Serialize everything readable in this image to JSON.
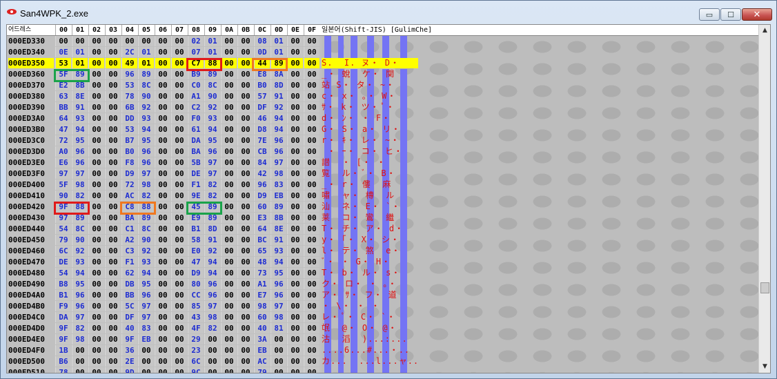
{
  "window": {
    "title": "San4WPK_2.exe",
    "minimize": "▭",
    "maximize": "☐",
    "close": "✕"
  },
  "header": {
    "address_label": "어드레스",
    "columns": [
      "00",
      "01",
      "02",
      "03",
      "04",
      "05",
      "06",
      "07",
      "08",
      "09",
      "0A",
      "0B",
      "0C",
      "0D",
      "0E",
      "0F"
    ],
    "text_label": "일본어(Shift-JIS) [GulimChe]"
  },
  "rows": [
    {
      "addr": "000ED330",
      "bytes": [
        "00",
        "00",
        "00",
        "00",
        "00",
        "00",
        "00",
        "00",
        "02",
        "01",
        "00",
        "00",
        "08",
        "01",
        "00",
        "00"
      ],
      "text": ""
    },
    {
      "addr": "000ED340",
      "bytes": [
        "0E",
        "01",
        "00",
        "00",
        "2C",
        "01",
        "00",
        "00",
        "07",
        "01",
        "00",
        "00",
        "0D",
        "01",
        "00",
        "00"
      ],
      "text": ""
    },
    {
      "addr": "000ED350",
      "bytes": [
        "53",
        "01",
        "00",
        "00",
        "49",
        "01",
        "00",
        "00",
        "C7",
        "88",
        "00",
        "00",
        "44",
        "89",
        "00",
        "00"
      ],
      "text": "S.  I. ヌ・ D・  ",
      "highlight": true
    },
    {
      "addr": "000ED360",
      "bytes": [
        "5F",
        "89",
        "00",
        "00",
        "96",
        "89",
        "00",
        "00",
        "B9",
        "89",
        "00",
        "00",
        "E8",
        "8A",
        "00",
        "00"
      ],
      "text": "_・ 蛻  ケ・ 関 "
    },
    {
      "addr": "000ED370",
      "bytes": [
        "E2",
        "8B",
        "00",
        "00",
        "53",
        "8C",
        "00",
        "00",
        "C0",
        "8C",
        "00",
        "00",
        "B0",
        "8D",
        "00",
        "00"
      ],
      "text": "站 S・ タ・ ~・"
    },
    {
      "addr": "000ED380",
      "bytes": [
        "63",
        "8E",
        "00",
        "00",
        "78",
        "90",
        "00",
        "00",
        "A1",
        "90",
        "00",
        "00",
        "57",
        "91",
        "00",
        "00"
      ],
      "text": "c・ x・ ｡・ W・"
    },
    {
      "addr": "000ED390",
      "bytes": [
        "BB",
        "91",
        "00",
        "00",
        "6B",
        "92",
        "00",
        "00",
        "C2",
        "92",
        "00",
        "00",
        "DF",
        "92",
        "00",
        "00"
      ],
      "text": "ｻ・ k・ ツ・ ﾟ・"
    },
    {
      "addr": "000ED3A0",
      "bytes": [
        "64",
        "93",
        "00",
        "00",
        "DD",
        "93",
        "00",
        "00",
        "F0",
        "93",
        "00",
        "00",
        "46",
        "94",
        "00",
        "00"
      ],
      "text": "d・ ﾝ・ ・ F・"
    },
    {
      "addr": "000ED3B0",
      "bytes": [
        "47",
        "94",
        "00",
        "00",
        "53",
        "94",
        "00",
        "00",
        "61",
        "94",
        "00",
        "00",
        "D8",
        "94",
        "00",
        "00"
      ],
      "text": "G・ S・ a・ リ・"
    },
    {
      "addr": "000ED3C0",
      "bytes": [
        "72",
        "95",
        "00",
        "00",
        "B7",
        "95",
        "00",
        "00",
        "DA",
        "95",
        "00",
        "00",
        "7E",
        "96",
        "00",
        "00"
      ],
      "text": "r・ ｷ・ レ・ ~・"
    },
    {
      "addr": "000ED3D0",
      "bytes": [
        "A0",
        "96",
        "00",
        "00",
        "B0",
        "96",
        "00",
        "00",
        "BA",
        "96",
        "00",
        "00",
        "CB",
        "96",
        "00",
        "00"
      ],
      "text": " ・ ｰ・ コ・ ヒ・"
    },
    {
      "addr": "000ED3E0",
      "bytes": [
        "E6",
        "96",
        "00",
        "00",
        "F8",
        "96",
        "00",
        "00",
        "5B",
        "97",
        "00",
        "00",
        "84",
        "97",
        "00",
        "00"
      ],
      "text": "譛  ・ [・ ・"
    },
    {
      "addr": "000ED3F0",
      "bytes": [
        "97",
        "97",
        "00",
        "00",
        "D9",
        "97",
        "00",
        "00",
        "DE",
        "97",
        "00",
        "00",
        "42",
        "98",
        "00",
        "00"
      ],
      "text": "覧  ル・ ﾞ・ B・"
    },
    {
      "addr": "000ED400",
      "bytes": [
        "5F",
        "98",
        "00",
        "00",
        "72",
        "98",
        "00",
        "00",
        "F1",
        "82",
        "00",
        "00",
        "96",
        "83",
        "00",
        "00"
      ],
      "text": "_・ r・ 僂  麻"
    },
    {
      "addr": "000ED410",
      "bytes": [
        "90",
        "82",
        "00",
        "00",
        "AC",
        "82",
        "00",
        "00",
        "9E",
        "82",
        "00",
        "00",
        "D9",
        "EB",
        "00",
        "00"
      ],
      "text": "嘯  ャ・ 槫  ル"
    },
    {
      "addr": "000ED420",
      "bytes": [
        "9F",
        "88",
        "00",
        "00",
        "C8",
        "88",
        "00",
        "00",
        "45",
        "89",
        "00",
        "00",
        "60",
        "89",
        "00",
        "00"
      ],
      "text": "汕  ネ・ E・ `・"
    },
    {
      "addr": "000ED430",
      "bytes": [
        "97",
        "89",
        "00",
        "00",
        "BA",
        "89",
        "00",
        "00",
        "E9",
        "89",
        "00",
        "00",
        "E3",
        "8B",
        "00",
        "00"
      ],
      "text": "莱  コ・ 鸞  繼"
    },
    {
      "addr": "000ED440",
      "bytes": [
        "54",
        "8C",
        "00",
        "00",
        "C1",
        "8C",
        "00",
        "00",
        "B1",
        "8D",
        "00",
        "00",
        "64",
        "8E",
        "00",
        "00"
      ],
      "text": "T・ チ・ ア・ d・"
    },
    {
      "addr": "000ED450",
      "bytes": [
        "79",
        "90",
        "00",
        "00",
        "A2",
        "90",
        "00",
        "00",
        "58",
        "91",
        "00",
        "00",
        "BC",
        "91",
        "00",
        "00"
      ],
      "text": "y・ ｢・ X・ シ・"
    },
    {
      "addr": "000ED460",
      "bytes": [
        "6C",
        "92",
        "00",
        "00",
        "C3",
        "92",
        "00",
        "00",
        "E0",
        "92",
        "00",
        "00",
        "65",
        "93",
        "00",
        "00"
      ],
      "text": "l・ テ・ 煞  e・"
    },
    {
      "addr": "000ED470",
      "bytes": [
        "DE",
        "93",
        "00",
        "00",
        "F1",
        "93",
        "00",
        "00",
        "47",
        "94",
        "00",
        "00",
        "48",
        "94",
        "00",
        "00"
      ],
      "text": "ﾞ・ ・ G・ H・"
    },
    {
      "addr": "000ED480",
      "bytes": [
        "54",
        "94",
        "00",
        "00",
        "62",
        "94",
        "00",
        "00",
        "D9",
        "94",
        "00",
        "00",
        "73",
        "95",
        "00",
        "00"
      ],
      "text": "T・ b・ ル・ s・"
    },
    {
      "addr": "000ED490",
      "bytes": [
        "B8",
        "95",
        "00",
        "00",
        "DB",
        "95",
        "00",
        "00",
        "80",
        "96",
        "00",
        "00",
        "A1",
        "96",
        "00",
        "00"
      ],
      "text": "ク・ ロ・ ・ ｡・"
    },
    {
      "addr": "000ED4A0",
      "bytes": [
        "B1",
        "96",
        "00",
        "00",
        "BB",
        "96",
        "00",
        "00",
        "CC",
        "96",
        "00",
        "00",
        "E7",
        "96",
        "00",
        "00"
      ],
      "text": "ア・ ｻ・ フ・ 道"
    },
    {
      "addr": "000ED4B0",
      "bytes": [
        "F9",
        "96",
        "00",
        "00",
        "5C",
        "97",
        "00",
        "00",
        "85",
        "97",
        "00",
        "00",
        "98",
        "97",
        "00",
        "00"
      ],
      "text": "・ \\・ ・ ・"
    },
    {
      "addr": "000ED4C0",
      "bytes": [
        "DA",
        "97",
        "00",
        "00",
        "DF",
        "97",
        "00",
        "00",
        "43",
        "98",
        "00",
        "00",
        "60",
        "98",
        "00",
        "00"
      ],
      "text": "レ・ ﾟ・ C・ `・"
    },
    {
      "addr": "000ED4D0",
      "bytes": [
        "9F",
        "82",
        "00",
        "00",
        "40",
        "83",
        "00",
        "00",
        "4F",
        "82",
        "00",
        "00",
        "40",
        "81",
        "00",
        "00"
      ],
      "text": "氓  @・ O・ @・"
    },
    {
      "addr": "000ED4E0",
      "bytes": [
        "9F",
        "98",
        "00",
        "00",
        "9F",
        "EB",
        "00",
        "00",
        "29",
        "00",
        "00",
        "00",
        "3A",
        "00",
        "00",
        "00"
      ],
      "text": "沽  滔  )...:..."
    },
    {
      "addr": "000ED4F0",
      "bytes": [
        "1B",
        "00",
        "00",
        "00",
        "36",
        "00",
        "00",
        "00",
        "23",
        "00",
        "00",
        "00",
        "EB",
        "00",
        "00",
        "00"
      ],
      "text": "....6...#...・.."
    },
    {
      "addr": "000ED500",
      "bytes": [
        "B6",
        "00",
        "00",
        "00",
        "2E",
        "00",
        "00",
        "00",
        "6C",
        "00",
        "00",
        "00",
        "AC",
        "00",
        "00",
        "00"
      ],
      "text": "カ...  ...l...ャ.."
    },
    {
      "addr": "000ED510",
      "bytes": [
        "78",
        "00",
        "00",
        "00",
        "9D",
        "00",
        "00",
        "00",
        "9C",
        "00",
        "00",
        "00",
        "79",
        "00",
        "00",
        "00"
      ],
      "text": ""
    }
  ],
  "colors": {
    "highlight": "#ffff00",
    "byte_nonzero": "#1c2bd2",
    "text": "#dd1111",
    "box_red": "#e01a1a",
    "box_orange": "#f07820",
    "box_green": "#1aa34a",
    "stripe": "#7474f4"
  },
  "icons": {
    "app": "red-eye-icon",
    "scroll_up": "chevron-up-icon",
    "scroll_down": "chevron-down-icon"
  }
}
